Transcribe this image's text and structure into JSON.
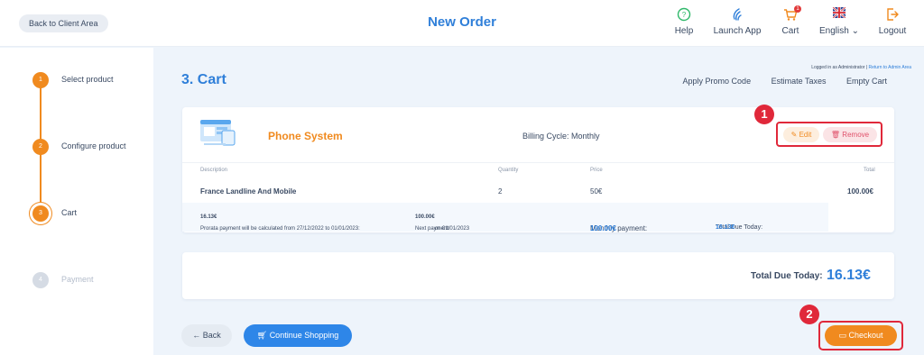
{
  "header": {
    "back_label": "Back to Client Area",
    "title": "New Order",
    "nav": [
      {
        "label": "Help",
        "icon": "help-icon"
      },
      {
        "label": "Launch App",
        "icon": "launch-app-icon"
      },
      {
        "label": "Cart",
        "icon": "cart-icon",
        "badge": "1"
      },
      {
        "label": "English",
        "icon": "uk-flag-icon"
      },
      {
        "label": "Logout",
        "icon": "logout-icon"
      }
    ]
  },
  "steps": [
    {
      "num": "1",
      "label": "Select product",
      "state": "done"
    },
    {
      "num": "2",
      "label": "Configure product",
      "state": "done"
    },
    {
      "num": "3",
      "label": "Cart",
      "state": "current"
    },
    {
      "num": "4",
      "label": "Payment",
      "state": "inactive"
    }
  ],
  "main": {
    "title": "3. Cart",
    "logged_in": "Logged in as Administrator",
    "admin_link": "Return to Admin Area",
    "actions": [
      "Apply Promo Code",
      "Estimate Taxes",
      "Empty Cart"
    ]
  },
  "product": {
    "name": "Phone System",
    "billing": "Billing Cycle: Monthly",
    "edit_label": "Edit",
    "remove_label": "Remove",
    "headers": {
      "description": "Description",
      "quantity": "Quantity",
      "price": "Price",
      "total": "Total"
    },
    "row": {
      "description": "France Landline And Mobile",
      "quantity": "2",
      "price": "50€",
      "total": "100.00€"
    },
    "footer": {
      "prorata_prefix": "Prorata payment will be calculated from 27/12/2022 to 01/01/2023:",
      "prorata_amount": "16.13€",
      "next_prefix": "Next payment:",
      "next_amount": "100.00€",
      "next_suffix": "on 01/01/2023",
      "monthly_label": "Monthly payment:",
      "monthly_amount": "100.00€",
      "due_label": "Total Due Today:",
      "due_amount": "16.13€"
    }
  },
  "summary": {
    "total_label": "Total Due Today:",
    "total_value": "16.13€"
  },
  "buttons": {
    "back": "Back",
    "continue": "Continue Shopping",
    "checkout": "Checkout"
  },
  "annotations": [
    "1",
    "2"
  ],
  "colors": {
    "accent": "#f08a1f",
    "primary": "#2f7fd9",
    "highlight": "#e0283a"
  }
}
